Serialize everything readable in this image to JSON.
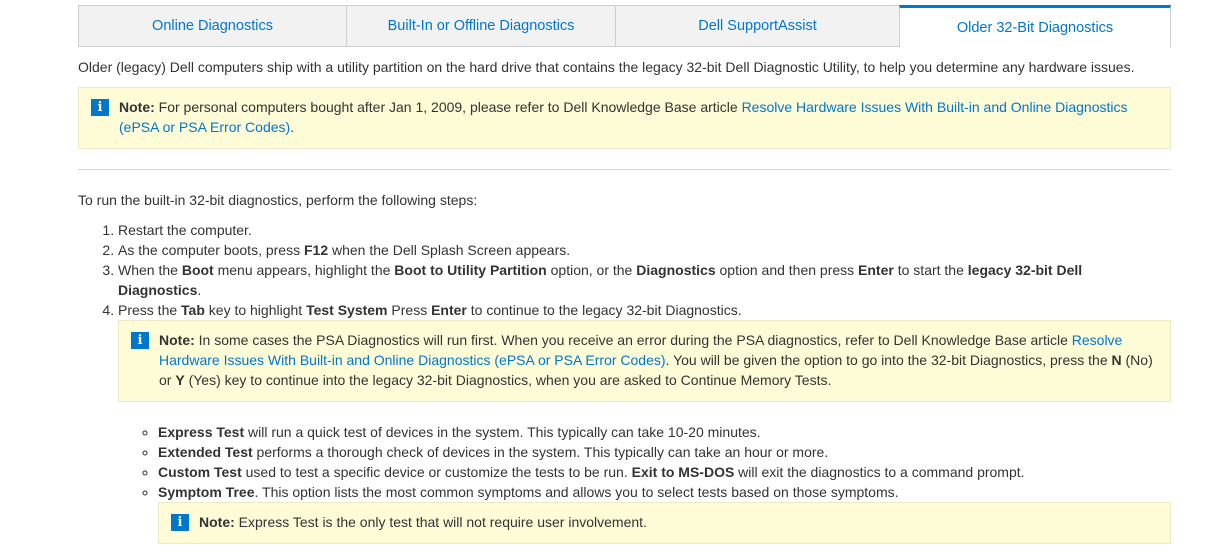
{
  "tabs": [
    {
      "label": "Online Diagnostics",
      "active": false
    },
    {
      "label": "Built-In or Offline Diagnostics",
      "active": false
    },
    {
      "label": "Dell SupportAssist",
      "active": false
    },
    {
      "label": "Older 32-Bit Diagnostics",
      "active": true
    }
  ],
  "intro": "Older (legacy) Dell computers ship with a utility partition on the hard drive that contains the legacy 32-bit Dell Diagnostic Utility, to help you determine any hardware issues.",
  "note_label": "Note:",
  "info_glyph": "i",
  "note1": {
    "text": " For personal computers bought after Jan 1, 2009, please refer to Dell Knowledge Base article ",
    "link": "Resolve Hardware Issues With Built-in and Online Diagnostics (ePSA or PSA Error Codes)",
    "after": "."
  },
  "steps_lead": "To run the built-in 32-bit diagnostics, perform the following steps:",
  "steps": {
    "s1": "Restart the computer.",
    "s2": {
      "a": "As the computer boots, press ",
      "b1": "F12",
      "c": " when the Dell Splash Screen appears."
    },
    "s3": {
      "a": "When the ",
      "b1": "Boot",
      "c": " menu appears, highlight the ",
      "b2": "Boot to Utility Partition",
      "d": " option, or the ",
      "b3": "Diagnostics",
      "e": " option and then press ",
      "b4": "Enter",
      "f": " to start the ",
      "b5": "legacy 32-bit Dell Diagnostics",
      "g": "."
    },
    "s4": {
      "a": "Press the ",
      "b1": "Tab",
      "c": " key to highlight ",
      "b2": "Test System",
      "d": " Press ",
      "b3": "Enter",
      "e": " to continue to the legacy 32-bit Diagnostics."
    }
  },
  "note2": {
    "text": " In some cases the PSA Diagnostics will run first. When you receive an error during the PSA diagnostics, refer to Dell Knowledge Base article ",
    "link": "Resolve Hardware Issues With Built-in and Online Diagnostics (ePSA or PSA Error Codes)",
    "mid": ". You will be given the option to go into the 32-bit Diagnostics, press the ",
    "n": "N",
    "mid2": " (No) or ",
    "y": "Y",
    "end": " (Yes) key to continue into the legacy 32-bit Diagnostics, when you are asked to Continue Memory Tests."
  },
  "tests": {
    "t1": {
      "b": "Express Test",
      "t": " will run a quick test of devices in the system. This typically can take 10-20 minutes."
    },
    "t2": {
      "b": "Extended Test",
      "t": " performs a thorough check of devices in the system. This typically can take an hour or more."
    },
    "t3": {
      "b": "Custom Test",
      "t": " used to test a specific device or customize the tests to be run. ",
      "b2": "Exit to MS-DOS",
      "t2": " will exit the diagnostics to a command prompt."
    },
    "t4": {
      "b": "Symptom Tree",
      "t": ". This option lists the most common symptoms and allows you to select tests based on those symptoms."
    }
  },
  "note3": {
    "text": " Express Test is the only test that will not require user involvement."
  },
  "colors": {
    "link": "#0076ce",
    "note_bg": "#fefcd6",
    "tab_bg": "#f2f2f2"
  }
}
